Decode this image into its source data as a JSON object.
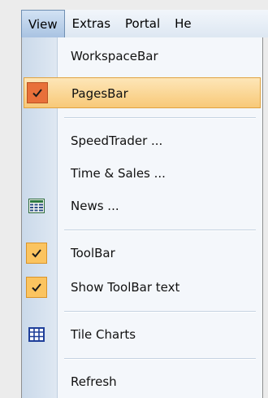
{
  "menubar": {
    "items": [
      "View",
      "Extras",
      "Portal",
      "He"
    ]
  },
  "menu": {
    "items": [
      {
        "label": "WorkspaceBar"
      },
      {
        "label": "PagesBar",
        "checked": true,
        "highlighted": true
      },
      {
        "label": "SpeedTrader ..."
      },
      {
        "label": "Time & Sales ..."
      },
      {
        "label": "News ...",
        "icon": "news-icon"
      },
      {
        "label": "ToolBar",
        "checked": true
      },
      {
        "label": "Show ToolBar text",
        "checked": true
      },
      {
        "label": "Tile Charts",
        "icon": "grid-table-icon"
      },
      {
        "label": "Refresh"
      }
    ]
  },
  "colors": {
    "highlight": "#f8c978",
    "check_background": "#fbc460",
    "check_highlighted_background": "#e8703a"
  }
}
